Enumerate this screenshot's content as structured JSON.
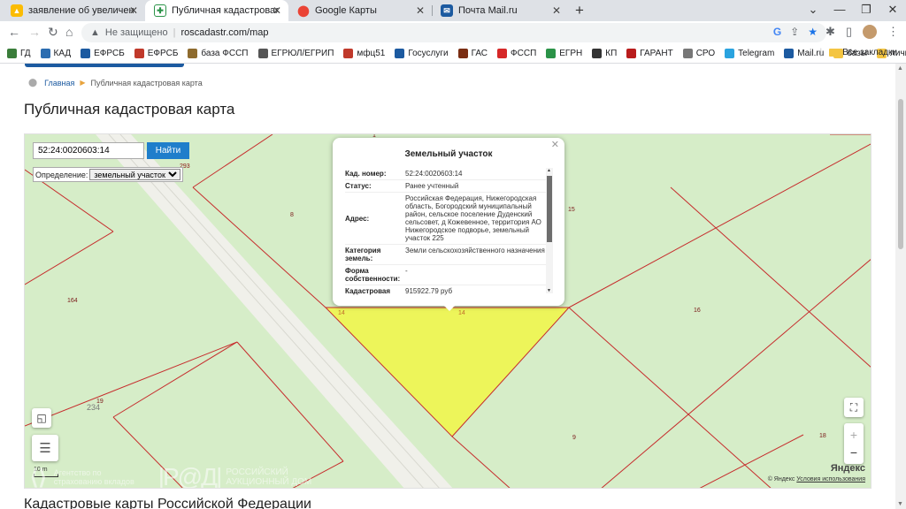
{
  "browser": {
    "tabs": [
      {
        "title": "заявление об увеличении иск",
        "icon": "google-drive-icon",
        "active": false
      },
      {
        "title": "Публичная кадастровая карта",
        "icon": "rosreestr-icon",
        "active": true
      },
      {
        "title": "Google Карты",
        "icon": "google-maps-icon",
        "active": false
      },
      {
        "title": "Почта Mail.ru",
        "icon": "mail-icon",
        "active": false
      }
    ],
    "address": {
      "security_label": "Не защищено",
      "url": "roscadastr.com/map"
    },
    "bookmarks": [
      {
        "label": "ГД",
        "color": "#3a7d3a"
      },
      {
        "label": "КАД",
        "color": "#2b6cb0"
      },
      {
        "label": "ЕФРСБ",
        "color": "#1c5aa0"
      },
      {
        "label": "ЕФРСБ",
        "color": "#c0392b"
      },
      {
        "label": "база ФССП",
        "color": "#8e6b2e"
      },
      {
        "label": "ЕГРЮЛ/ЕГРИП",
        "color": "#555555"
      },
      {
        "label": "мфц51",
        "color": "#c0392b"
      },
      {
        "label": "Госуслуги",
        "color": "#1c5aa0"
      },
      {
        "label": "ГАС",
        "color": "#7a2d12"
      },
      {
        "label": "ФССП",
        "color": "#d62828"
      },
      {
        "label": "ЕГРН",
        "color": "#2b9348"
      },
      {
        "label": "КП",
        "color": "#333333"
      },
      {
        "label": "ГАРАНТ",
        "color": "#b91c1c"
      },
      {
        "label": "СРО",
        "color": "#777777"
      },
      {
        "label": "Telegram",
        "color": "#2aa3df"
      },
      {
        "label": "Mail.ru",
        "color": "#1c5aa0"
      },
      {
        "label": "базы",
        "color": "#f4c542"
      },
      {
        "label": "личное",
        "color": "#f4c542"
      }
    ],
    "all_bookmarks_label": "Все закладки"
  },
  "page": {
    "breadcrumb": {
      "home": "Главная",
      "current": "Публичная кадастровая карта"
    },
    "title": "Публичная кадастровая карта",
    "bottom_title": "Кадастровые карты Российской Федерации"
  },
  "map": {
    "search": {
      "value": "52:24:0020603:14",
      "button": "Найти"
    },
    "definition": {
      "label": "Определение:",
      "selected": "земельный участок"
    },
    "parcel_labels": {
      "n293": "293",
      "n8": "8",
      "n15": "15",
      "n164": "164",
      "n14a": "14",
      "n14b": "14",
      "n16": "16",
      "n19": "19",
      "n234": "234",
      "n9": "9",
      "n18": "18",
      "n1": "1"
    },
    "popup": {
      "title": "Земельный участок",
      "rows": [
        {
          "key": "Кад. номер:",
          "value": "52:24:0020603:14"
        },
        {
          "key": "Статус:",
          "value": "Ранее учтенный"
        },
        {
          "key": "Адрес:",
          "value": "Российская Федерация, Нижегородская область, Богородский муниципальный район, сельское поселение Дуденский сельсовет, д Кожевенное, территория АО Нижегородское подворье, земельный участок 225"
        },
        {
          "key": "Категория земель:",
          "value": "Земли сельскохозяйственного назначения"
        },
        {
          "key": "Форма собственности:",
          "value": "-"
        },
        {
          "key": "Кадастровая стоимость:",
          "value": "915922.79 руб"
        }
      ]
    },
    "scale": "10 m",
    "watermark": {
      "left_text": "Агентство по страхованию вкладов",
      "right_text": "РОССИЙСКИЙ АУКЦИОННЫЙ ДОМ"
    },
    "attribution": {
      "brand": "Яндекс",
      "copyright": "© Яндекс",
      "terms": "Условия использования"
    },
    "colors": {
      "map_bg": "#d6edc8",
      "selected_parcel": "#edf55a",
      "boundary": "#c62d2d",
      "road": "#f0f0ea"
    }
  }
}
